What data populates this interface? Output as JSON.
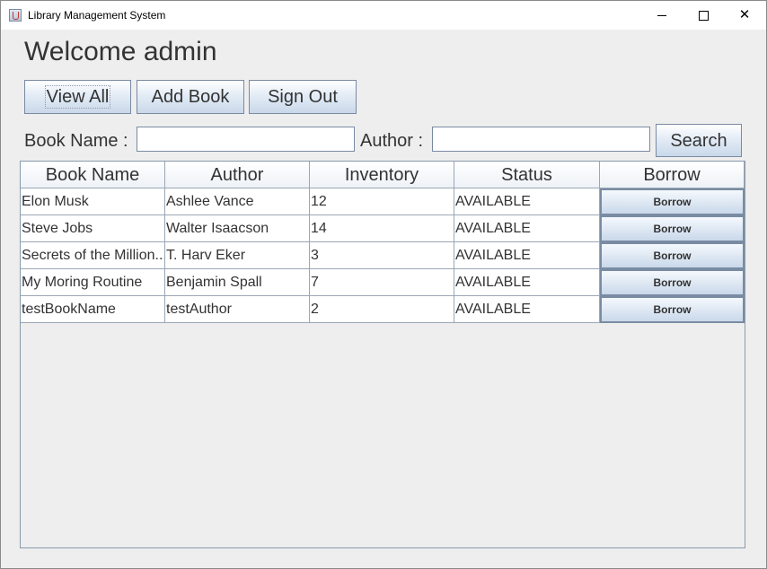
{
  "window": {
    "title": "Library Management System"
  },
  "header": {
    "welcome": "Welcome admin"
  },
  "toolbar": {
    "view_all": "View All",
    "add_book": "Add Book",
    "sign_out": "Sign Out"
  },
  "search": {
    "book_name_label": "Book Name :",
    "book_name_value": "",
    "author_label": "Author :",
    "author_value": "",
    "search_button": "Search"
  },
  "table": {
    "columns": [
      "Book Name",
      "Author",
      "Inventory",
      "Status",
      "Borrow"
    ],
    "rows": [
      {
        "book_name": "Elon Musk",
        "author": "Ashlee Vance",
        "inventory": "12",
        "status": "AVAILABLE",
        "action": "Borrow"
      },
      {
        "book_name": "Steve Jobs",
        "author": "Walter Isaacson",
        "inventory": "14",
        "status": "AVAILABLE",
        "action": "Borrow"
      },
      {
        "book_name": "Secrets of the Million...",
        "author": "T. Harv Eker",
        "inventory": "3",
        "status": "AVAILABLE",
        "action": "Borrow"
      },
      {
        "book_name": "My Moring Routine",
        "author": "Benjamin Spall",
        "inventory": "7",
        "status": "AVAILABLE",
        "action": "Borrow"
      },
      {
        "book_name": "testBookName",
        "author": "testAuthor",
        "inventory": "2",
        "status": "AVAILABLE",
        "action": "Borrow"
      }
    ]
  }
}
